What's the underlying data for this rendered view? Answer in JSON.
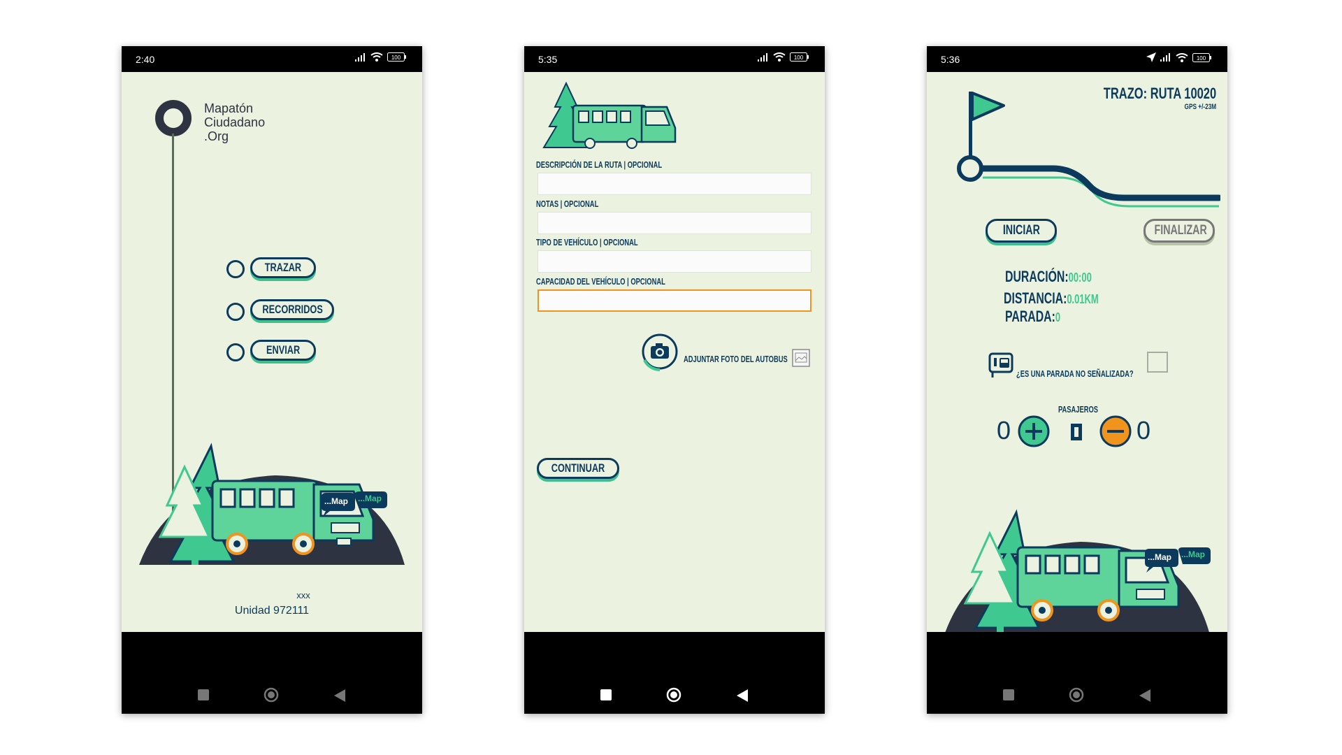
{
  "screens": [
    {
      "status_time": "2:40",
      "battery": "100",
      "logo": {
        "line1": "Mapatón",
        "line2": "Ciudadano",
        "line3": ".Org"
      },
      "menu": [
        "TRAZAR",
        "RECORRIDOS",
        "ENVIAR"
      ],
      "speech": {
        "a": "...Map",
        "b": "...Map"
      },
      "footer": {
        "line1": "xxx",
        "line2": "Unidad 972111"
      }
    },
    {
      "status_time": "5:35",
      "battery": "100",
      "fields": [
        {
          "label": "DESCRIPCIÓN DE LA RUTA  |  OPCIONAL",
          "value": ""
        },
        {
          "label": "NOTAS  |  OPCIONAL",
          "value": ""
        },
        {
          "label": "TIPO DE VEHÍCULO  |  OPCIONAL",
          "value": ""
        },
        {
          "label": "CAPACIDAD DEL VEHÍCULO  |  OPCIONAL",
          "value": ""
        }
      ],
      "attach_label": "ADJUNTAR FOTO DEL AUTOBUS",
      "continue_label": "CONTINUAR"
    },
    {
      "status_time": "5:36",
      "battery": "100",
      "title": "TRAZO: RUTA 10020",
      "gps": "GPS +/-23M",
      "start_label": "INICIAR",
      "finish_label": "FINALIZAR",
      "duration_label": "DURACIÓN:",
      "duration_value": "00:00",
      "distance_label": "DISTANCIA:",
      "distance_value": "0.01KM",
      "stop_label": "PARADA:",
      "stop_value": "0",
      "unsignaled_label": "¿ES UNA PARADA NO SEÑALIZADA?",
      "passengers_label": "PASAJEROS",
      "passengers_left": "0",
      "passengers_right": "0",
      "speech": {
        "a": "...Map",
        "b": "...Map"
      }
    }
  ],
  "colors": {
    "navy": "#0c3a5c",
    "mint": "#3fc88f",
    "cream": "#ebf2e0",
    "orange": "#f0941e",
    "hill": "#2d3340"
  }
}
